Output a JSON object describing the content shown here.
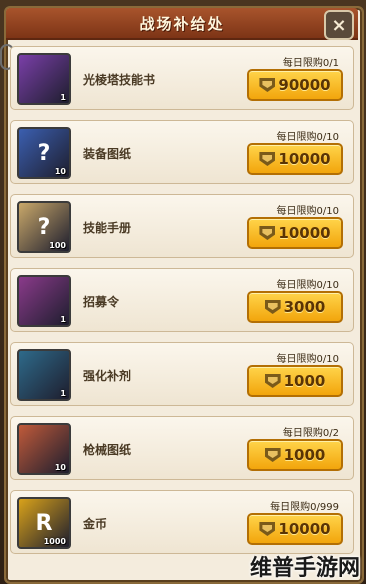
{
  "title": "战场补给处",
  "close_label": "×",
  "watermark": "维普手游网",
  "items": [
    {
      "name": "光棱塔技能书",
      "limit": "每日限购0/1",
      "price": "90000",
      "qty": "1",
      "icon_glyph": "",
      "icon": "skill-book-icon",
      "icon_color": "#7a3fa8"
    },
    {
      "name": "装备图纸",
      "limit": "每日限购0/10",
      "price": "10000",
      "qty": "10",
      "icon_glyph": "?",
      "icon": "equipment-blueprint-icon",
      "icon_color": "#3b5fb0"
    },
    {
      "name": "技能手册",
      "limit": "每日限购0/10",
      "price": "10000",
      "qty": "100",
      "icon_glyph": "?",
      "icon": "skill-manual-icon",
      "icon_color": "#c9a86a"
    },
    {
      "name": "招募令",
      "limit": "每日限购0/10",
      "price": "3000",
      "qty": "1",
      "icon_glyph": "",
      "icon": "recruit-order-icon",
      "icon_color": "#8a3a8a"
    },
    {
      "name": "强化补剂",
      "limit": "每日限购0/10",
      "price": "1000",
      "qty": "1",
      "icon_glyph": "",
      "icon": "enhance-syringe-icon",
      "icon_color": "#2e6a8a"
    },
    {
      "name": "枪械图纸",
      "limit": "每日限购0/2",
      "price": "1000",
      "qty": "10",
      "icon_glyph": "",
      "icon": "gun-blueprint-icon",
      "icon_color": "#c05a3a"
    },
    {
      "name": "金币",
      "limit": "每日限购0/999",
      "price": "10000",
      "qty": "1000",
      "icon_glyph": "R",
      "icon": "gold-coin-icon",
      "icon_color": "#d9a21a"
    }
  ]
}
